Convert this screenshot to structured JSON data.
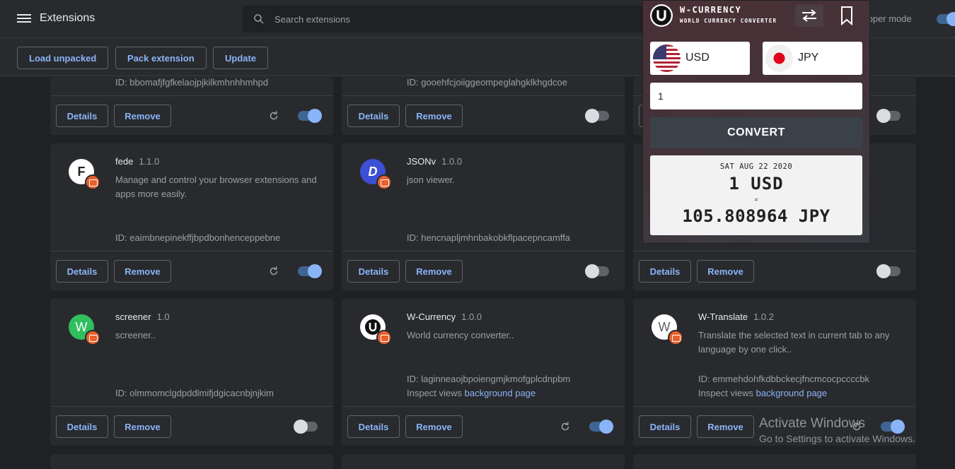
{
  "header": {
    "title": "Extensions",
    "search_placeholder": "Search extensions",
    "devmode_label": "veloper mode",
    "devmode_on": true
  },
  "toolbar": {
    "load_unpacked": "Load unpacked",
    "pack_extension": "Pack extension",
    "update": "Update"
  },
  "card_buttons": {
    "details": "Details",
    "remove": "Remove"
  },
  "cards_row1": [
    {
      "id": "ID: bbomafjfgfkelaojpjkilkmhnhhmhpd",
      "enabled": true,
      "reload": true
    },
    {
      "id": "ID: gooehfcjoiiggeompeglahgklkhgdcoe",
      "enabled": false,
      "reload": false
    },
    {
      "enabled": false,
      "reload": false
    }
  ],
  "cards_row2": [
    {
      "name": "fede",
      "version": "1.1.0",
      "description": "Manage and control your browser extensions and apps more easily.",
      "id": "ID: eaimbnepinekffjbpdbonhenceppebne",
      "icon": "f-letter-icon",
      "enabled": true,
      "reload": true
    },
    {
      "name": "JSONv",
      "version": "1.0.0",
      "description": "json viewer.",
      "id": "ID: hencnapljmhnbakobkflpacepncamffa",
      "icon": "d-letter-icon",
      "enabled": false,
      "reload": false
    },
    {
      "enabled": false,
      "reload": false
    }
  ],
  "cards_row3": [
    {
      "name": "screener",
      "version": "1.0",
      "description": "screener..",
      "id": "ID: olmmomclgdpddlmifjdgicacnbjnjkim",
      "icon": "w-green-icon",
      "icon_letter": "W",
      "enabled": false,
      "reload": false
    },
    {
      "name": "W-Currency",
      "version": "1.0.0",
      "description": "World currency converter..",
      "id": "ID: laginneaojbpoiengmjkmofgplcdnpbm",
      "inspect_label": "Inspect views",
      "inspect_link": "background page",
      "icon": "u-logo-icon",
      "enabled": true,
      "reload": true
    },
    {
      "name": "W-Translate",
      "version": "1.0.2",
      "description": "Translate the selected text in current tab to any language by one click..",
      "id": "ID: emmehdohfkdbbckecjfncmcocpccccbk",
      "inspect_label": "Inspect views",
      "inspect_link": "background page",
      "icon": "w-white-icon",
      "icon_letter": "W",
      "enabled": true,
      "reload": true
    }
  ],
  "popup": {
    "title": "W-CURRENCY",
    "subtitle": "WORLD CURRENCY CONVERTER",
    "from_code": "USD",
    "to_code": "JPY",
    "amount": "1",
    "convert_label": "CONVERT",
    "date": "SAT AUG 22 2020",
    "from_result": "1 USD",
    "equals": "=",
    "to_result": "105.808964 JPY"
  },
  "watermark": {
    "title": "Activate Windows",
    "subtitle": "Go to Settings to activate Windows."
  },
  "colors": {
    "background": "#202124",
    "surface": "#292a2d",
    "accent": "#8ab4f8",
    "badge": "#e8602c"
  }
}
